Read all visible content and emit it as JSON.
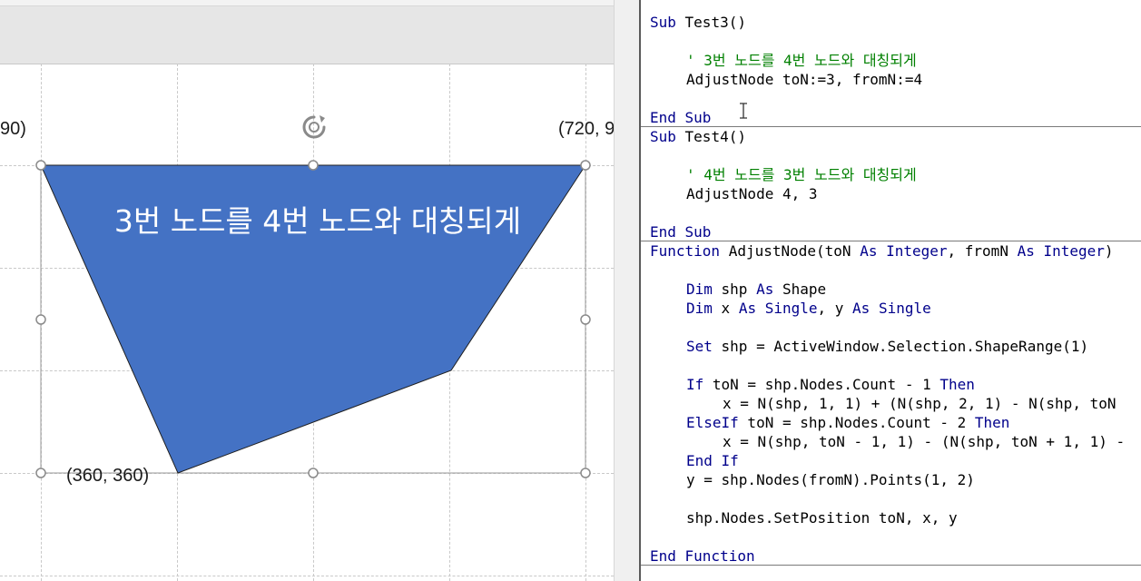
{
  "slide": {
    "shape_text": "3번 노드를 4번 노드와 대칭되게",
    "coord_left_top": "90)",
    "coord_right_top": "(720, 9",
    "coord_bottom": "(360, 360)",
    "fill_color": "#4472c4"
  },
  "code": {
    "colors": {
      "keyword": "#00008b",
      "comment": "#008000"
    },
    "test3": {
      "sub_kw": "Sub",
      "header_rest": " Test3()",
      "comment": "' 3번 노드를 4번 노드와 대칭되게",
      "call": "AdjustNode toN:=3, fromN:=4",
      "end_kw": "End Sub"
    },
    "test4": {
      "sub_kw": "Sub",
      "header_rest": " Test4()",
      "comment": "' 4번 노드를 3번 노드와 대칭되게",
      "call": "AdjustNode 4, 3",
      "end_kw": "End Sub"
    },
    "adjust": {
      "function_kw": "Function",
      "sig_1": " AdjustNode(toN ",
      "as_kw_1": "As",
      "int_kw_1": " Integer",
      "sig_2": ", fromN ",
      "as_kw_2": "As",
      "int_kw_2": " Integer",
      "sig_3": ")",
      "dim1_kw": "Dim",
      "dim1_a": " shp ",
      "dim1_as": "As",
      "dim1_b": " Shape",
      "dim2_kw": "Dim",
      "dim2_a": " x ",
      "dim2_as1": "As",
      "dim2_single1": " Single",
      "dim2_b": ", y ",
      "dim2_as2": "As",
      "dim2_single2": " Single",
      "set_kw": "Set",
      "set_rest": " shp = ActiveWindow.Selection.ShapeRange(1)",
      "if_kw": "If",
      "if_mid": " toN = shp.Nodes.Count - 1 ",
      "then_kw_1": "Then",
      "x_line_1": "x = N(shp, 1, 1) + (N(shp, 2, 1) - N(shp, toN",
      "elseif_kw": "ElseIf",
      "elseif_mid": " toN = shp.Nodes.Count - 2 ",
      "then_kw_2": "Then",
      "x_line_2": "x = N(shp, toN - 1, 1) - (N(shp, toN + 1, 1) -",
      "endif_kw": "End If",
      "y_line": "y = shp.Nodes(fromN).Points(1, 2)",
      "setpos_line": "shp.Nodes.SetPosition toN, x, y",
      "end_kw": "End Function"
    }
  }
}
